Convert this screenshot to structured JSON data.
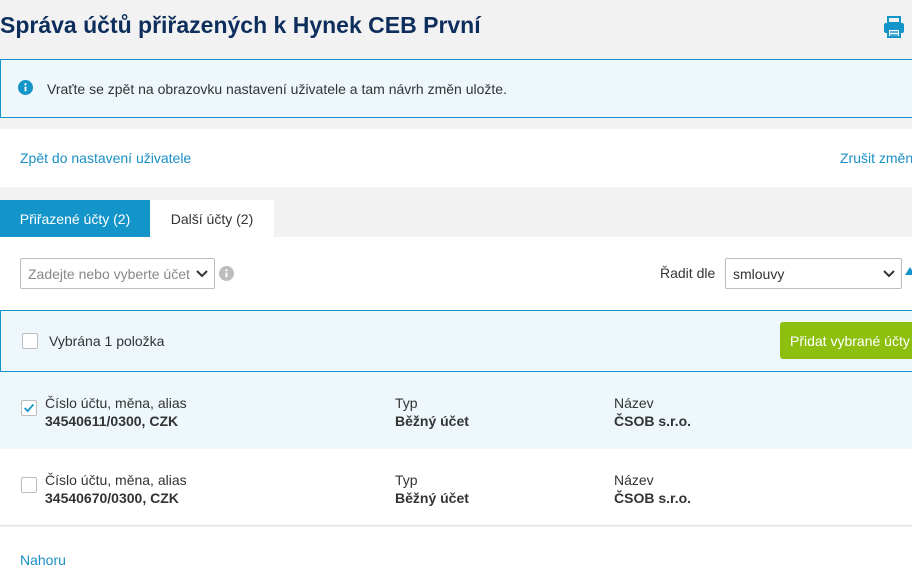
{
  "page": {
    "title": "Správa účtů přiřazených k Hynek CEB První"
  },
  "icons": {
    "print": "print-icon",
    "info": "info-icon",
    "help": "help-icon",
    "chevron": "chevron-down-icon",
    "check": "check-icon",
    "sort": "sort-direction-icon"
  },
  "colors": {
    "accent": "#1495c9",
    "title": "#0d2e5c",
    "button_green": "#8cbf0e",
    "info_bg": "#eef7fc"
  },
  "info": {
    "text": "Vraťte se zpět na obrazovku nastavení uživatele a tam návrh změn uložte."
  },
  "links": {
    "back": "Zpět do nastavení uživatele",
    "cancel": "Zrušit změn",
    "top": "Nahoru"
  },
  "tabs": [
    {
      "label": "Přiřazené účty (2)",
      "active": true
    },
    {
      "label": "Další účty (2)",
      "active": false
    }
  ],
  "filter": {
    "account_placeholder": "Zadejte nebo vyberte účet",
    "sort_label": "Řadit dle",
    "sort_value": "smlouvy"
  },
  "selection": {
    "text": "Vybrána 1 položka",
    "add_button": "Přidat vybrané účty",
    "all_checked": false
  },
  "accounts": [
    {
      "checked": true,
      "account_label": "Číslo účtu, měna, alias",
      "account": "34540611/0300, CZK",
      "type_label": "Typ",
      "type": "Běžný účet",
      "name_label": "Název",
      "name": "ČSOB s.r.o."
    },
    {
      "checked": false,
      "account_label": "Číslo účtu, měna, alias",
      "account": "34540670/0300, CZK",
      "type_label": "Typ",
      "type": "Běžný účet",
      "name_label": "Název",
      "name": "ČSOB s.r.o."
    }
  ]
}
